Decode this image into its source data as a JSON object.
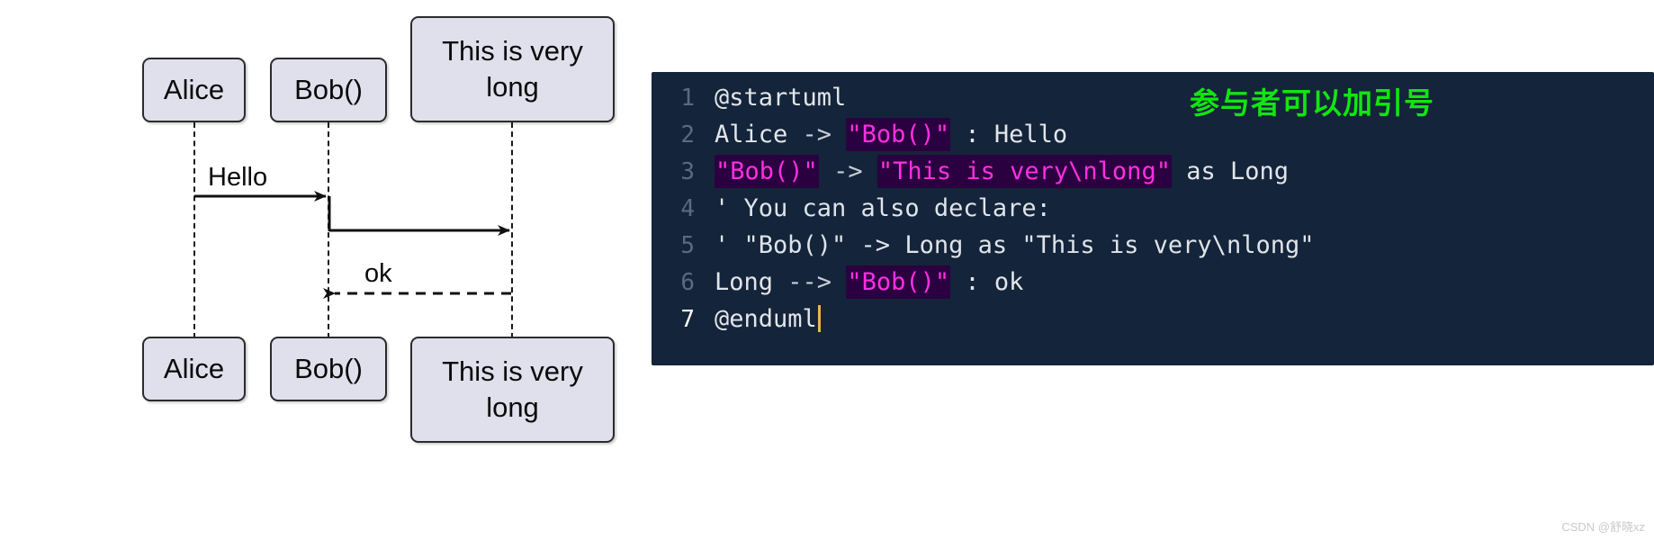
{
  "diagram": {
    "participants": [
      {
        "name": "Alice",
        "label": "Alice"
      },
      {
        "name": "Bob",
        "label": "Bob()"
      },
      {
        "name": "Long",
        "label": "This is very\nlong"
      }
    ],
    "messages": [
      {
        "label": "Hello",
        "from": "Alice",
        "to": "Bob",
        "style": "solid"
      },
      {
        "label": "",
        "from": "Bob",
        "to": "Long",
        "style": "solid"
      },
      {
        "label": "ok",
        "from": "Long",
        "to": "Bob",
        "style": "dashed"
      }
    ],
    "box_fill": "#e0e0ec",
    "box_border": "#2b2b2b",
    "line_color": "#181818"
  },
  "editor": {
    "background": "#14243a",
    "string_color": "#ff2fe0",
    "string_bg": "#2b0040",
    "text_color": "#e2e6ea",
    "gutter_color": "#5a6b80",
    "active_line": 7,
    "cursor_after": "@enduml",
    "lines": [
      {
        "number": "1",
        "tokens": [
          {
            "type": "plain",
            "text": "@startuml"
          }
        ]
      },
      {
        "number": "2",
        "tokens": [
          {
            "type": "plain",
            "text": "Alice "
          },
          {
            "type": "arrow",
            "text": "->"
          },
          {
            "type": "plain",
            "text": " "
          },
          {
            "type": "string",
            "text": "\"Bob()\""
          },
          {
            "type": "plain",
            "text": " : Hello"
          }
        ]
      },
      {
        "number": "3",
        "tokens": [
          {
            "type": "string",
            "text": "\"Bob()\""
          },
          {
            "type": "plain",
            "text": " "
          },
          {
            "type": "arrow",
            "text": "->"
          },
          {
            "type": "plain",
            "text": " "
          },
          {
            "type": "string",
            "text": "\"This is very\\nlong\""
          },
          {
            "type": "plain",
            "text": " as Long"
          }
        ]
      },
      {
        "number": "4",
        "tokens": [
          {
            "type": "comment",
            "text": "' You can also declare:"
          }
        ]
      },
      {
        "number": "5",
        "tokens": [
          {
            "type": "comment",
            "text": "' \"Bob()\" -> Long as \"This is very\\nlong\""
          }
        ]
      },
      {
        "number": "6",
        "tokens": [
          {
            "type": "plain",
            "text": "Long "
          },
          {
            "type": "arrow",
            "text": "-->"
          },
          {
            "type": "plain",
            "text": " "
          },
          {
            "type": "string",
            "text": "\"Bob()\""
          },
          {
            "type": "plain",
            "text": " : ok"
          }
        ]
      },
      {
        "number": "7",
        "tokens": [
          {
            "type": "plain",
            "text": "@enduml"
          }
        ],
        "cursor": true
      }
    ]
  },
  "annotation": {
    "text": "参与者可以加引号",
    "color": "#12e512"
  },
  "watermark": {
    "text": "CSDN @舒晓xz"
  }
}
